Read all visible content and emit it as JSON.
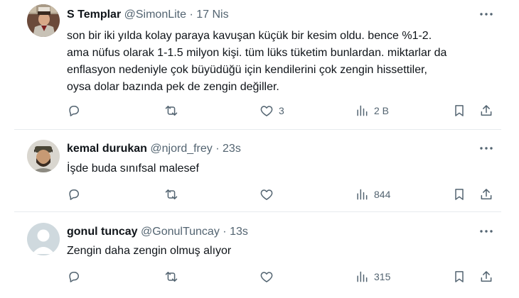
{
  "tweets": [
    {
      "name": "S Templar",
      "handle": "@SimonLite",
      "sep": "·",
      "time": "17 Nis",
      "lines": [
        "son bir iki yılda kolay paraya kavuşan küçük bir kesim oldu. bence %1-2.",
        "ama nüfus olarak 1-1.5 milyon kişi. tüm lüks tüketim bunlardan. miktarlar da",
        "enflasyon nedeniyle çok büyüdüğü için kendilerini çok zengin hissettiler,",
        "oysa dolar bazında pek de zengin değiller."
      ],
      "likes": "3",
      "views": "2 B"
    },
    {
      "name": "kemal durukan",
      "handle": "@njord_frey",
      "sep": "·",
      "time": "23s",
      "lines": [
        "İşde buda sınıfsal malesef"
      ],
      "likes": "",
      "views": "844"
    },
    {
      "name": "gonul tuncay",
      "handle": "@GonulTuncay",
      "sep": "·",
      "time": "13s",
      "lines": [
        "Zengin daha zengin olmuş alıyor"
      ],
      "likes": "",
      "views": "315"
    }
  ],
  "icons": {
    "reply": "reply-icon",
    "retweet": "retweet-icon",
    "like": "heart-icon",
    "views": "views-icon",
    "bookmark": "bookmark-icon",
    "share": "share-icon",
    "more": "more-icon"
  },
  "colors": {
    "text": "#0f1419",
    "secondary": "#536471",
    "divider": "#e7ebee"
  }
}
